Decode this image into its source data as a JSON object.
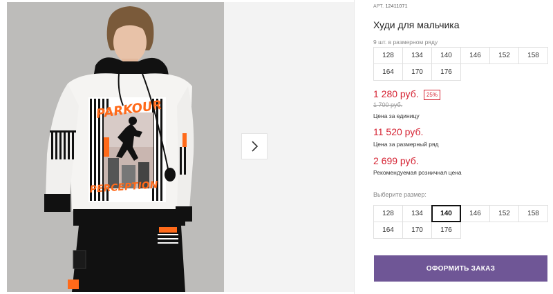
{
  "product": {
    "sku_label": "АРТ.",
    "sku_number": "12411071",
    "title": "Худи для мальчика",
    "size_row_caption": "9 шт. в размерном ряду"
  },
  "size_row": [
    "128",
    "134",
    "140",
    "146",
    "152",
    "158",
    "164",
    "170",
    "176"
  ],
  "prices": {
    "unit_price": "1 280 руб.",
    "discount": "25%",
    "old_price": "1 700 руб.",
    "unit_label": "Цена за единицу",
    "row_price": "11 520 руб.",
    "row_label": "Цена за размерный ряд",
    "retail_price": "2 699 руб.",
    "retail_label": "Рекомендуемая розничная цена"
  },
  "size_picker": {
    "caption": "Выберите размер:",
    "sizes": [
      "128",
      "134",
      "140",
      "146",
      "152",
      "158",
      "164",
      "170",
      "176"
    ],
    "selected": "140"
  },
  "order_button": "ОФОРМИТЬ ЗАКАЗ",
  "photo": {
    "print_text_top": "PARKOUR",
    "print_text_bottom": "PERCEPTION"
  },
  "colors": {
    "price_red": "#d52232",
    "button_purple": "#6f5696",
    "photo_background": "#bdbcba",
    "hoodie_white": "#f5f4f2",
    "accent_orange": "#ff6a1a"
  },
  "icons": {
    "next": "chevron-right-icon"
  }
}
